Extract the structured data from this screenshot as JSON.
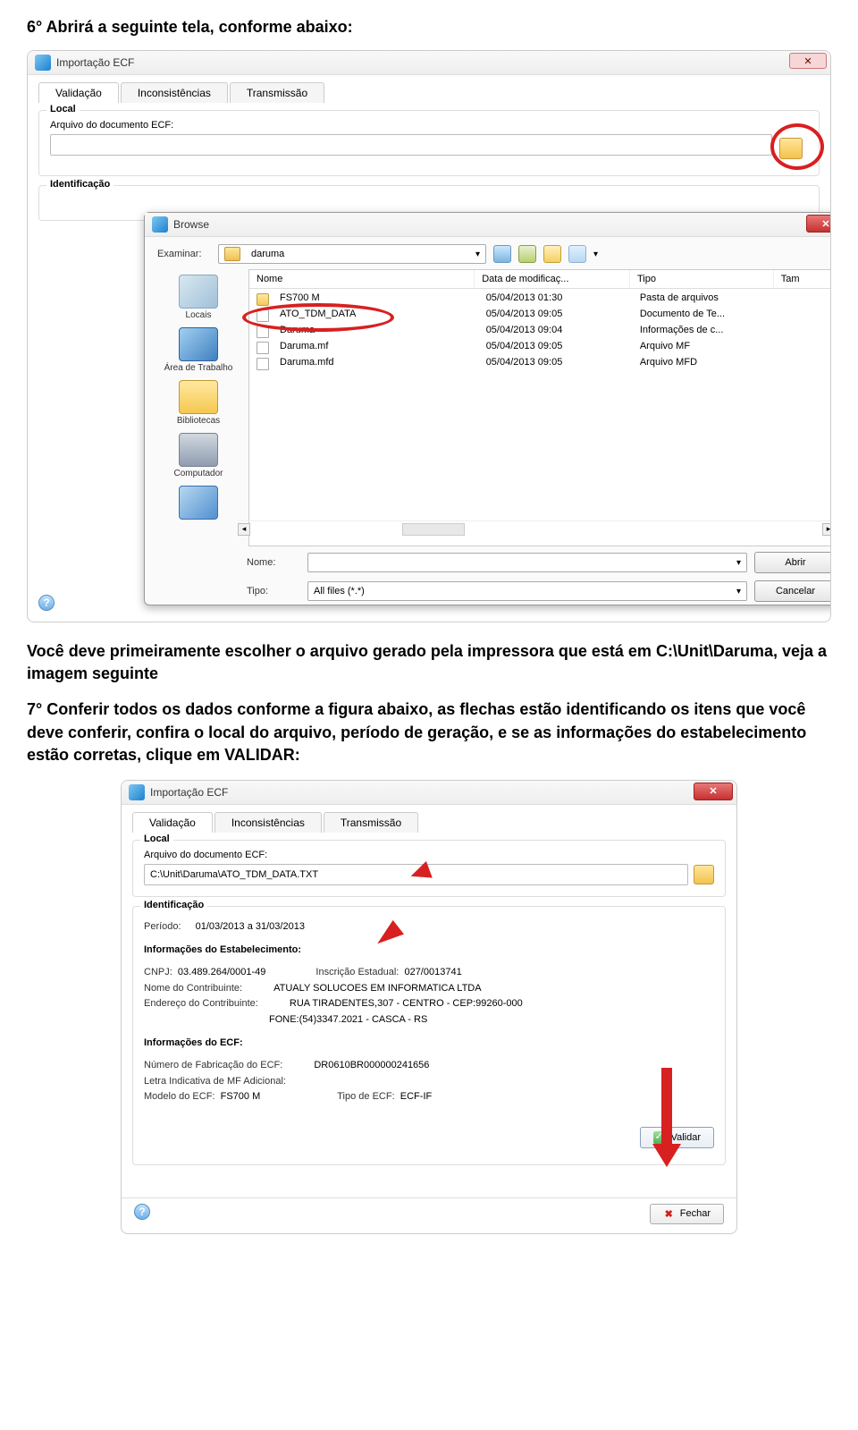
{
  "doc": {
    "h1": "6° Abrirá a seguinte tela, conforme abaixo:",
    "p_mid": "Você deve primeiramente escolher o arquivo gerado pela impressora que está em C:\\Unit\\Daruma, veja a imagem seguinte",
    "h2": "7° Conferir todos os dados conforme a figura abaixo, as flechas estão identificando os itens que você deve conferir, confira o local do arquivo, período de geração, e se as informações do estabelecimento estão corretas, clique em VALIDAR:"
  },
  "s1": {
    "title": "Importação ECF",
    "tabs": {
      "validacao": "Validação",
      "incons": "Inconsistências",
      "trans": "Transmissão"
    },
    "local_legend": "Local",
    "arquivo_label": "Arquivo do documento ECF:",
    "ident_legend": "Identificação",
    "browse": {
      "title": "Browse",
      "examinar": "Examinar:",
      "folder": "daruma",
      "cols": {
        "nome": "Nome",
        "data": "Data de modificaç...",
        "tipo": "Tipo",
        "tam": "Tam"
      },
      "rows": [
        {
          "name": "FS700 M",
          "date": "05/04/2013 01:30",
          "type": "Pasta de arquivos",
          "folder": true
        },
        {
          "name": "ATO_TDM_DATA",
          "date": "05/04/2013 09:05",
          "type": "Documento de Te...",
          "folder": false
        },
        {
          "name": "Daruma",
          "date": "05/04/2013 09:04",
          "type": "Informações de c...",
          "folder": false
        },
        {
          "name": "Daruma.mf",
          "date": "05/04/2013 09:05",
          "type": "Arquivo MF",
          "folder": false
        },
        {
          "name": "Daruma.mfd",
          "date": "05/04/2013 09:05",
          "type": "Arquivo MFD",
          "folder": false
        }
      ],
      "places": {
        "locais": "Locais",
        "desktop": "Área de Trabalho",
        "bibs": "Bibliotecas",
        "comp": "Computador"
      },
      "nome_lbl": "Nome:",
      "tipo_lbl": "Tipo:",
      "tipo_val": "All files (*.*)",
      "abrir": "Abrir",
      "cancelar": "Cancelar"
    }
  },
  "s2": {
    "title": "Importação ECF",
    "tabs": {
      "validacao": "Validação",
      "incons": "Inconsistências",
      "trans": "Transmissão"
    },
    "local_legend": "Local",
    "arquivo_label": "Arquivo do documento ECF:",
    "arquivo_val": "C:\\Unit\\Daruma\\ATO_TDM_DATA.TXT",
    "ident_legend": "Identificação",
    "periodo_lbl": "Período:",
    "periodo_val": "01/03/2013   a   31/03/2013",
    "estab_h": "Informações do Estabelecimento:",
    "cnpj_l": "CNPJ:",
    "cnpj_v": "03.489.264/0001-49",
    "ie_l": "Inscrição Estadual:",
    "ie_v": "027/0013741",
    "nome_l": "Nome do Contribuinte:",
    "nome_v": "ATUALY SOLUCOES EM INFORMATICA LTDA",
    "end_l": "Endereço do Contribuinte:",
    "end_v1": "RUA TIRADENTES,307 - CENTRO - CEP:99260-000",
    "end_v2": "FONE:(54)3347.2021 - CASCA - RS",
    "ecf_h": "Informações do ECF:",
    "fab_l": "Número de Fabricação do ECF:",
    "fab_v": "DR0610BR000000241656",
    "letra_l": "Letra Indicativa de MF Adicional:",
    "modelo_l": "Modelo do ECF:",
    "modelo_v": "FS700 M",
    "tipo_l": "Tipo de ECF:",
    "tipo_v": "ECF-IF",
    "validar": "Validar",
    "fechar": "Fechar"
  }
}
